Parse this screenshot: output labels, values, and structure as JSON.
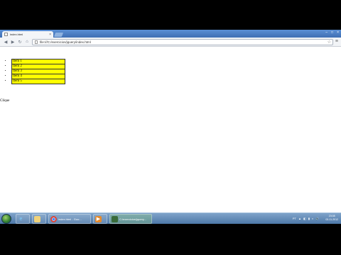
{
  "browser": {
    "tab_title": "index.html",
    "tab_close": "×",
    "url": "file:///C:/exercicios/jquery/index.html",
    "win_controls": [
      "‒",
      "□",
      "×"
    ],
    "back": "◀",
    "forward": "▶",
    "reload": "↻",
    "home": "⌂",
    "star": "☆",
    "wrench": "≡"
  },
  "page": {
    "items": [
      "Item 1",
      "Item 2",
      "Item 3",
      "Item 4",
      "Item 5"
    ],
    "click_label": "Clique"
  },
  "taskbar": {
    "apps": [
      {
        "icon": "ie-icon",
        "label": ""
      },
      {
        "icon": "folder-icon",
        "label": ""
      },
      {
        "icon": "chrome-icon",
        "label": "index.html - Goo..."
      },
      {
        "icon": "media-icon",
        "label": ""
      },
      {
        "icon": "cmd-icon",
        "label": "C:\\exercicios\\jquery..."
      }
    ],
    "tray": [
      "PT",
      "▲",
      "◧",
      "▮",
      "◐",
      "🔊"
    ],
    "clock_time": "23:08",
    "clock_date": "03-11-2012"
  },
  "colors": {
    "item_bg": "#ffff00",
    "tab_strip": "#4a7bbd",
    "taskbar": "#5b83b0"
  }
}
